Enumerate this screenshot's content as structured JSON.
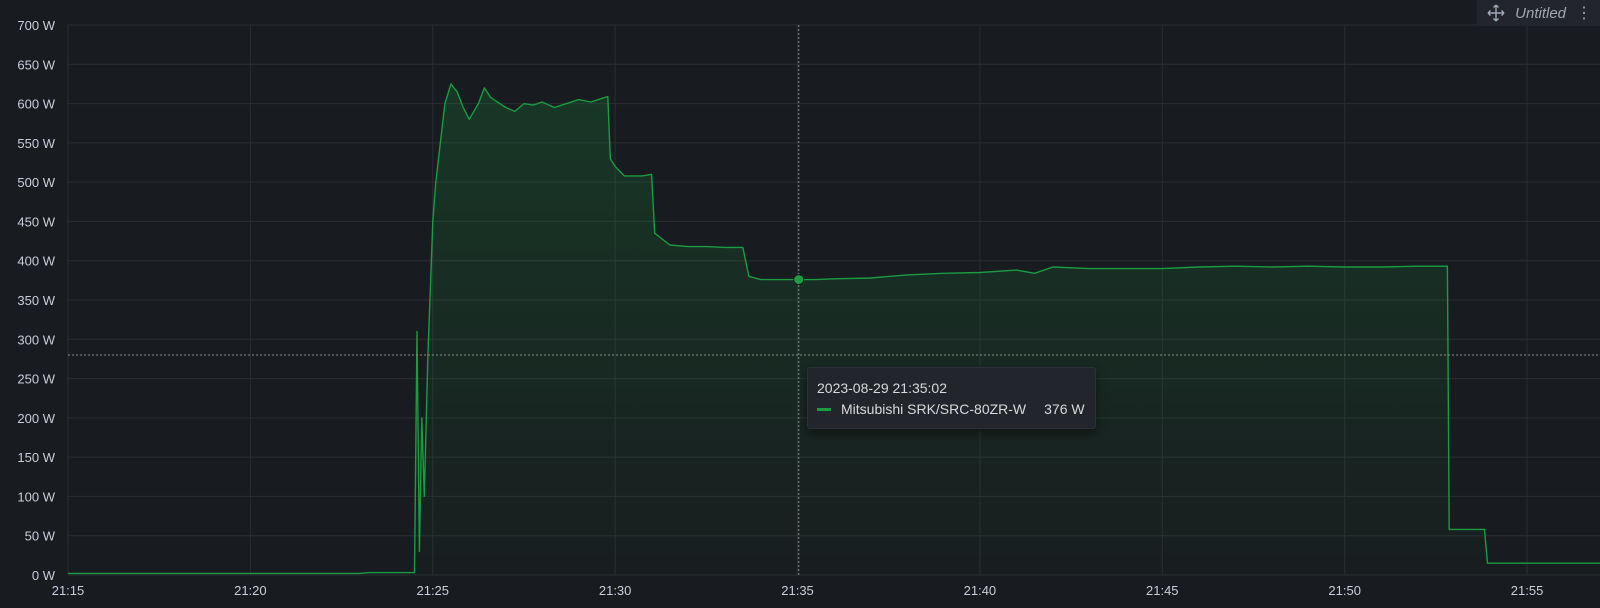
{
  "panel": {
    "title": "Untitled",
    "move_icon": "move-arrows-icon",
    "menu_icon": "vertical-ellipsis-icon"
  },
  "tooltip": {
    "time": "2023-08-29 21:35:02",
    "series_name": "Mitsubishi SRK/SRC-80ZR-W",
    "value": "376 W"
  },
  "colors": {
    "background": "#181b1f",
    "series": "#1a9c40",
    "grid": "#2a2d33",
    "text": "#ccccdc"
  },
  "chart_data": {
    "type": "area",
    "title": "",
    "xlabel": "",
    "ylabel": "",
    "unit": "W",
    "ylim": [
      0,
      700
    ],
    "xlim": [
      "21:15",
      "21:57"
    ],
    "grid": true,
    "legend": "none",
    "y_ticks": [
      "0 W",
      "50 W",
      "100 W",
      "150 W",
      "200 W",
      "250 W",
      "300 W",
      "350 W",
      "400 W",
      "450 W",
      "500 W",
      "550 W",
      "600 W",
      "650 W",
      "700 W"
    ],
    "x_ticks": [
      "21:15",
      "21:20",
      "21:25",
      "21:30",
      "21:35",
      "21:40",
      "21:45",
      "21:50",
      "21:55"
    ],
    "crosshair": {
      "x": "21:35:02",
      "y": 280
    },
    "series": [
      {
        "name": "Mitsubishi SRK/SRC-80ZR-W",
        "points": [
          [
            "21:15:00",
            2
          ],
          [
            "21:23:00",
            2
          ],
          [
            "21:23:15",
            3
          ],
          [
            "21:24:00",
            3
          ],
          [
            "21:24:30",
            3
          ],
          [
            "21:24:34",
            310
          ],
          [
            "21:24:38",
            30
          ],
          [
            "21:24:42",
            200
          ],
          [
            "21:24:46",
            100
          ],
          [
            "21:24:52",
            280
          ],
          [
            "21:25:00",
            450
          ],
          [
            "21:25:05",
            500
          ],
          [
            "21:25:20",
            600
          ],
          [
            "21:25:30",
            625
          ],
          [
            "21:25:40",
            615
          ],
          [
            "21:25:50",
            595
          ],
          [
            "21:26:00",
            580
          ],
          [
            "21:26:15",
            600
          ],
          [
            "21:26:25",
            620
          ],
          [
            "21:26:35",
            608
          ],
          [
            "21:27:00",
            595
          ],
          [
            "21:27:15",
            590
          ],
          [
            "21:27:30",
            600
          ],
          [
            "21:27:45",
            598
          ],
          [
            "21:28:00",
            602
          ],
          [
            "21:28:20",
            595
          ],
          [
            "21:28:40",
            600
          ],
          [
            "21:29:00",
            605
          ],
          [
            "21:29:20",
            602
          ],
          [
            "21:29:40",
            607
          ],
          [
            "21:29:48",
            609
          ],
          [
            "21:29:52",
            530
          ],
          [
            "21:30:00",
            520
          ],
          [
            "21:30:15",
            508
          ],
          [
            "21:30:45",
            508
          ],
          [
            "21:31:00",
            510
          ],
          [
            "21:31:05",
            435
          ],
          [
            "21:31:30",
            420
          ],
          [
            "21:32:00",
            418
          ],
          [
            "21:32:30",
            418
          ],
          [
            "21:33:00",
            417
          ],
          [
            "21:33:30",
            417
          ],
          [
            "21:33:40",
            380
          ],
          [
            "21:34:00",
            376
          ],
          [
            "21:34:30",
            376
          ],
          [
            "21:35:00",
            376
          ],
          [
            "21:35:30",
            376
          ],
          [
            "21:36:00",
            377
          ],
          [
            "21:37:00",
            378
          ],
          [
            "21:38:00",
            382
          ],
          [
            "21:39:00",
            384
          ],
          [
            "21:40:00",
            385
          ],
          [
            "21:41:00",
            388
          ],
          [
            "21:41:30",
            384
          ],
          [
            "21:42:00",
            392
          ],
          [
            "21:43:00",
            390
          ],
          [
            "21:44:00",
            390
          ],
          [
            "21:45:00",
            390
          ],
          [
            "21:46:00",
            392
          ],
          [
            "21:47:00",
            393
          ],
          [
            "21:48:00",
            392
          ],
          [
            "21:49:00",
            393
          ],
          [
            "21:50:00",
            392
          ],
          [
            "21:51:00",
            392
          ],
          [
            "21:52:00",
            393
          ],
          [
            "21:52:49",
            393
          ],
          [
            "21:52:52",
            58
          ],
          [
            "21:53:00",
            58
          ],
          [
            "21:53:30",
            58
          ],
          [
            "21:53:50",
            58
          ],
          [
            "21:53:55",
            15
          ],
          [
            "21:54:30",
            15
          ],
          [
            "21:55:00",
            15
          ],
          [
            "21:55:30",
            15
          ],
          [
            "21:56:00",
            15
          ],
          [
            "21:57:00",
            15
          ]
        ]
      }
    ]
  }
}
